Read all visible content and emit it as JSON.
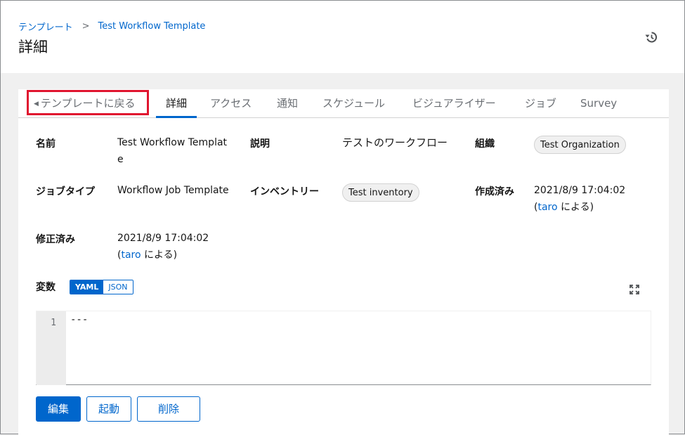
{
  "breadcrumb": {
    "parent": "テンプレート",
    "separator": ">",
    "current": "Test Workflow Template"
  },
  "page": {
    "title": "詳細"
  },
  "tabs": {
    "back": "テンプレートに戻る",
    "items": [
      "詳細",
      "アクセス",
      "通知",
      "スケジュール",
      "ビジュアライザー",
      "ジョブ",
      "Survey"
    ],
    "active": "詳細"
  },
  "details": {
    "name_label": "名前",
    "name_value_line1": "Test Workflow Templat",
    "name_value_line2": "e",
    "description_label": "説明",
    "description_value": "テストのワークフロー",
    "organization_label": "組織",
    "organization_value": "Test Organization",
    "job_type_label": "ジョブタイプ",
    "job_type_value": "Workflow Job Template",
    "inventory_label": "インベントリー",
    "inventory_value": "Test inventory",
    "created_label": "作成済み",
    "created_value": "2021/8/9 17:04:02",
    "created_by_open": "(",
    "created_by_user": "taro",
    "created_by_suffix": " による)",
    "modified_label": "修正済み",
    "modified_value": "2021/8/9 17:04:02",
    "modified_by_open": "(",
    "modified_by_user": "taro",
    "modified_by_suffix": " による)"
  },
  "variables": {
    "label": "変数",
    "toggle_yaml": "YAML",
    "toggle_json": "JSON",
    "selected": "YAML",
    "line_number": "1",
    "content": "---"
  },
  "actions": {
    "edit": "編集",
    "launch": "起動",
    "delete": "削除"
  },
  "colors": {
    "accent": "#0066cc",
    "highlight_border": "#e0152f"
  },
  "icons": {
    "history": "history-icon",
    "expand": "expand-icon"
  }
}
